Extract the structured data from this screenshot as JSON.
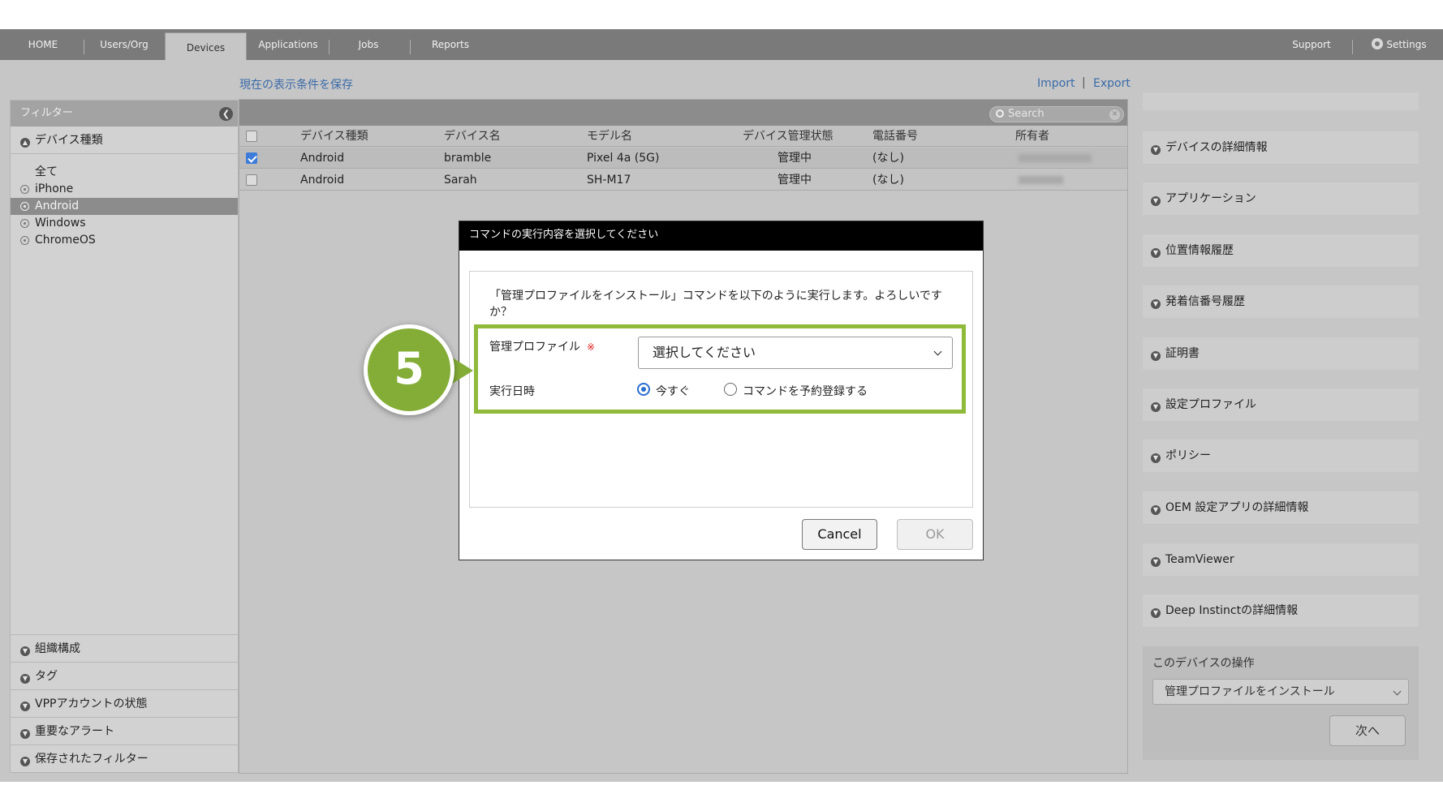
{
  "nav": {
    "tabs": [
      "HOME",
      "Users/Org",
      "Devices",
      "Applications",
      "Jobs",
      "Reports"
    ],
    "support": "Support",
    "settings": "Settings"
  },
  "toolbar": {
    "save_view": "現在の表示条件を保存",
    "import": "Import",
    "separator": "|",
    "export": "Export"
  },
  "filter": {
    "title": "フィルター",
    "collapse_icon": "chevron-left-icon",
    "device_type_section": "デバイス種類",
    "items": [
      "全て",
      "iPhone",
      "Android",
      "Windows",
      "ChromeOS"
    ],
    "selected": "Android",
    "bottom_sections": [
      "組織構成",
      "タグ",
      "VPPアカウントの状態",
      "重要なアラート",
      "保存されたフィルター"
    ]
  },
  "devices": {
    "search_placeholder": "Search",
    "columns": [
      "デバイス種類",
      "デバイス名",
      "モデル名",
      "デバイス管理状態",
      "電話番号",
      "所有者"
    ],
    "rows": [
      {
        "type": "Android",
        "name": "bramble",
        "model": "Pixel 4a (5G)",
        "status": "管理中",
        "phone": "(なし)",
        "checked": true
      },
      {
        "type": "Android",
        "name": "Sarah",
        "model": "SH-M17",
        "status": "管理中",
        "phone": "(なし)",
        "checked": false
      }
    ]
  },
  "right_panel": {
    "sections": [
      "デバイスの詳細情報",
      "アプリケーション",
      "位置情報履歴",
      "発着信番号履歴",
      "証明書",
      "設定プロファイル",
      "ポリシー",
      "OEM 設定アプリの詳細情報",
      "TeamViewer",
      "Deep Instinctの詳細情報"
    ],
    "operation_title": "このデバイスの操作",
    "operation_selected": "管理プロファイルをインストール",
    "next_button": "次へ"
  },
  "modal": {
    "title": "コマンドの実行内容を選択してください",
    "message": "「管理プロファイルをインストール」コマンドを以下のように実行します。よろしいですか？",
    "profile_label": "管理プロファイル",
    "required_mark": "※",
    "profile_select": "選択してください",
    "datetime_label": "実行日時",
    "radio_now": "今すぐ",
    "radio_schedule": "コマンドを予約登録する",
    "selected_option": "今すぐ",
    "cancel": "Cancel",
    "ok": "OK"
  },
  "step_marker": "5",
  "colors": {
    "nav_bg": "#7a7a7a",
    "highlight_green": "#8fba3a",
    "step_green": "#84ad37",
    "link_blue": "#3a6aa8",
    "radio_blue": "#2a6ed1"
  }
}
